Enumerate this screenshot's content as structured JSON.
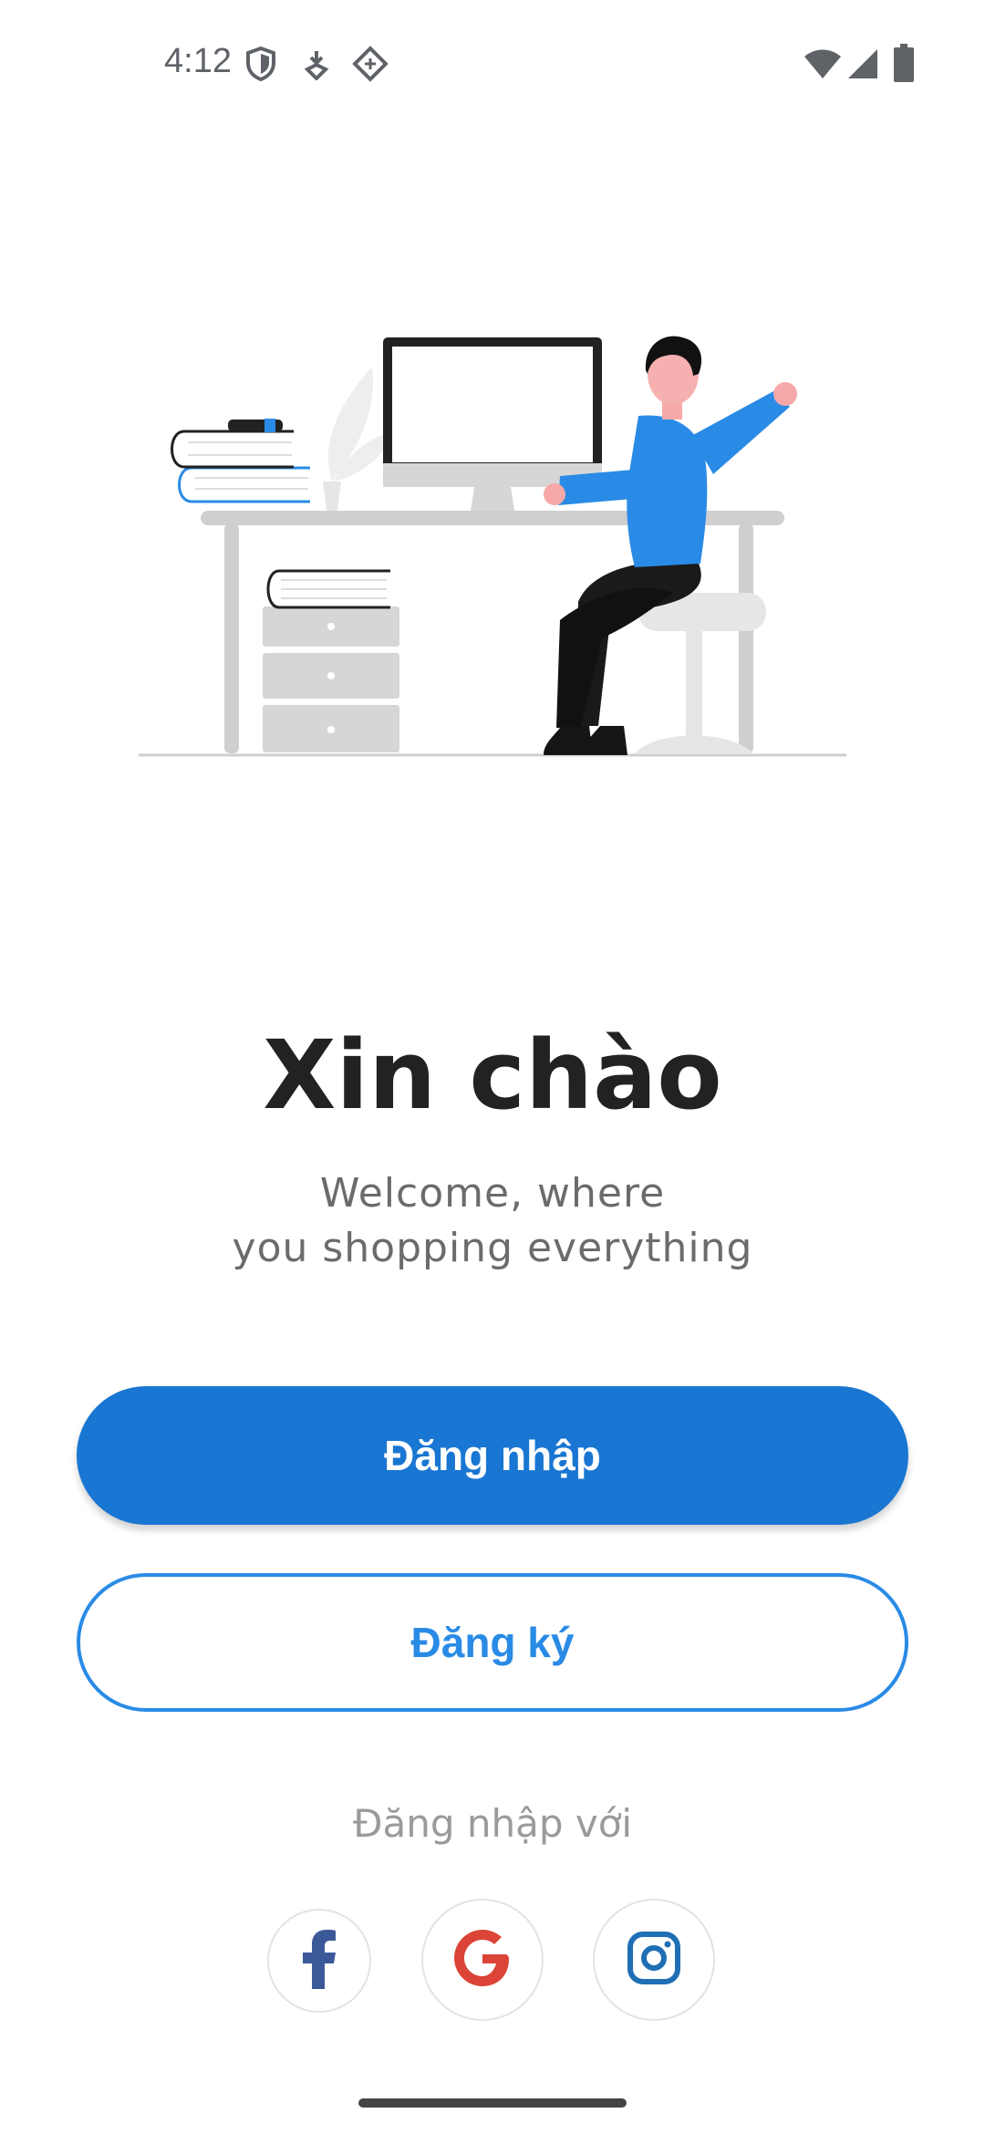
{
  "status_bar": {
    "time": "4:12",
    "icons": [
      "shield-icon",
      "download-icon",
      "vpn-icon",
      "wifi-icon",
      "cellular-signal-icon",
      "battery-icon"
    ]
  },
  "welcome": {
    "title": "Xin chào",
    "subtitle_line1": "Welcome, where",
    "subtitle_line2": "you shopping everything"
  },
  "buttons": {
    "login_label": "Đăng nhập",
    "register_label": "Đăng ký"
  },
  "social": {
    "label": "Đăng nhập với",
    "providers": [
      "facebook-icon",
      "google-icon",
      "instagram-icon"
    ]
  },
  "colors": {
    "primary": "#1976d2",
    "outline_accent": "#2a8be6",
    "facebook": "#3b5998",
    "google": "#db4437",
    "instagram": "#1f6fb5"
  }
}
